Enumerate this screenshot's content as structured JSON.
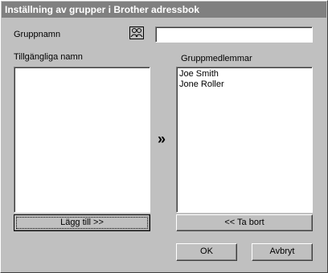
{
  "window": {
    "title": "Inställning av grupper i Brother adressbok"
  },
  "group_name": {
    "label": "Gruppnamn",
    "value": "",
    "icon": "group-people-icon"
  },
  "available": {
    "label": "Tillgängliga namn",
    "items": []
  },
  "members": {
    "label": "Gruppmedlemmar",
    "items": [
      "Joe Smith",
      "Jone Roller"
    ]
  },
  "buttons": {
    "add": "Lägg till >>",
    "remove": "<< Ta bort",
    "ok": "OK",
    "cancel": "Avbryt"
  },
  "transfer_glyph": "»"
}
